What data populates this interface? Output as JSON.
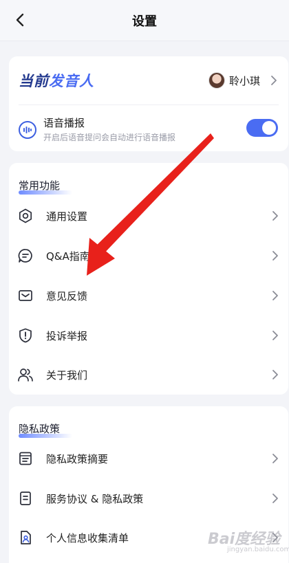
{
  "header": {
    "title": "设置"
  },
  "voice": {
    "speaker_title_part1": "当前",
    "speaker_title_part2": "发音人",
    "speaker_name": "聆小琪",
    "broadcast_title": "语音播报",
    "broadcast_desc": "开启后语音提问会自动进行语音播报",
    "broadcast_enabled": true
  },
  "common": {
    "heading": "常用功能",
    "items": [
      {
        "label": "通用设置",
        "icon": "gear-icon"
      },
      {
        "label": "Q&A指南",
        "icon": "chat-bubble-icon"
      },
      {
        "label": "意见反馈",
        "icon": "envelope-icon"
      },
      {
        "label": "投诉举报",
        "icon": "shield-alert-icon"
      },
      {
        "label": "关于我们",
        "icon": "users-icon"
      }
    ]
  },
  "privacy": {
    "heading": "隐私政策",
    "items": [
      {
        "label": "隐私政策摘要",
        "icon": "document-list-icon"
      },
      {
        "label": "服务协议 & 隐私政策",
        "icon": "document-icon"
      },
      {
        "label": "个人信息收集清单",
        "icon": "person-document-icon"
      }
    ]
  },
  "watermark": {
    "main": "Bai度经验",
    "sub": "jingyan.baidu.com"
  },
  "colors": {
    "accent": "#4a6cf2",
    "arrow": "#e8211b",
    "title_dark": "#243a8f"
  }
}
